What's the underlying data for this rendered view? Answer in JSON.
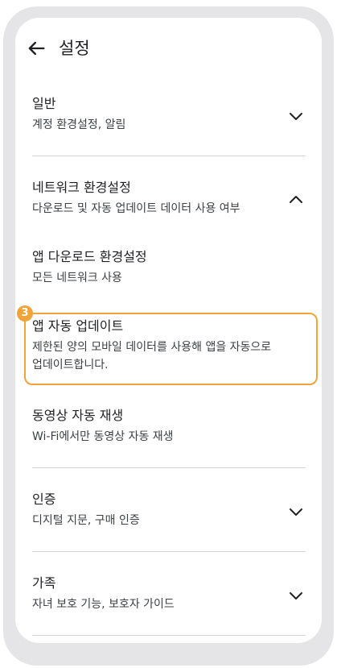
{
  "appbar": {
    "title": "설정",
    "back_icon": "arrow-left-icon"
  },
  "sections": [
    {
      "title": "일반",
      "subtitle": "계정 환경설정, 알림",
      "chevron": "chevron-down-icon"
    },
    {
      "title": "네트워크 환경설정",
      "subtitle": "다운로드 및 자동 업데이트 데이터 사용 여부",
      "chevron": "chevron-up-icon"
    },
    {
      "title": "앱 다운로드 환경설정",
      "subtitle": "모든 네트워크 사용"
    },
    {
      "title": "앱 자동 업데이트",
      "subtitle_line1": "제한된 양의 모바일 데이터를 사용해 앱을 자동으로",
      "subtitle_line2": "업데이트합니다."
    },
    {
      "title": "동영상 자동 재생",
      "subtitle": "Wi-Fi에서만 동영상 자동 재생"
    },
    {
      "title": "인증",
      "subtitle": "디지털 지문, 구매 인증",
      "chevron": "chevron-down-icon"
    },
    {
      "title": "가족",
      "subtitle": "자녀 보호 기능, 보호자 가이드",
      "chevron": "chevron-down-icon"
    }
  ],
  "annotation": {
    "step_number": "3",
    "accent_color": "#f2a33a"
  }
}
